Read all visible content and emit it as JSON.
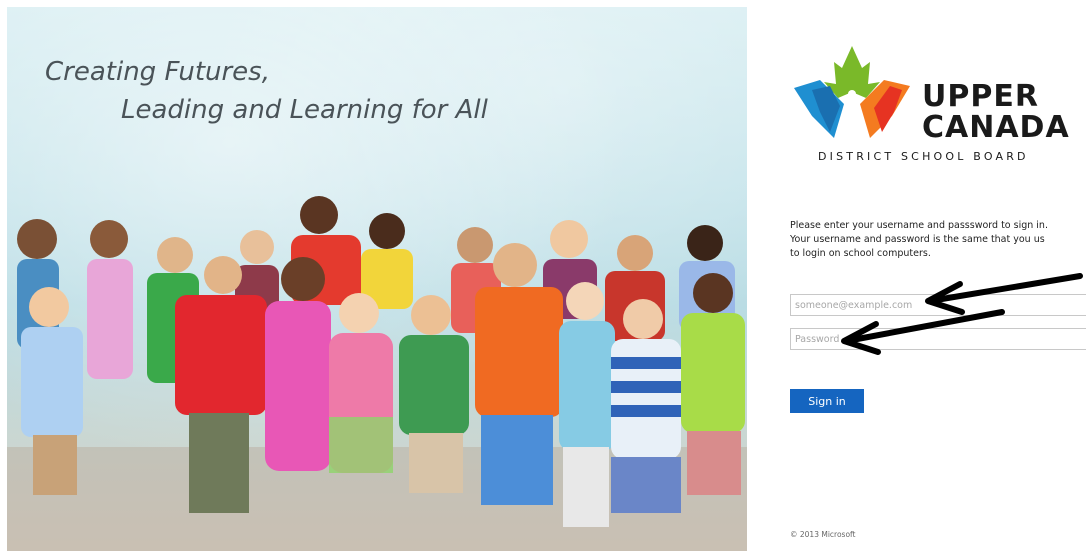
{
  "hero": {
    "tagline_line1": "Creating Futures,",
    "tagline_line2": "Leading and Learning for All"
  },
  "logo": {
    "word1": "UPPER",
    "word2": "CANADA",
    "subtitle": "DISTRICT SCHOOL BOARD",
    "icon": "maple-leaf-book-icon",
    "colors": {
      "green": "#7ab929",
      "blue": "#1f8fd1",
      "orange": "#f47b20",
      "red": "#e63322"
    }
  },
  "login": {
    "intro_line1": "Please enter your username and passsword to sign in.",
    "intro_line2": "Your username and password is the same that you us",
    "intro_line3": "to login on school computers.",
    "username_placeholder": "someone@example.com",
    "password_placeholder": "Password",
    "signin_label": "Sign in",
    "accent": "#1565c0"
  },
  "annotations": {
    "arrow_icon": "arrow-left-icon"
  },
  "footer": {
    "copyright": "© 2013 Microsoft"
  }
}
